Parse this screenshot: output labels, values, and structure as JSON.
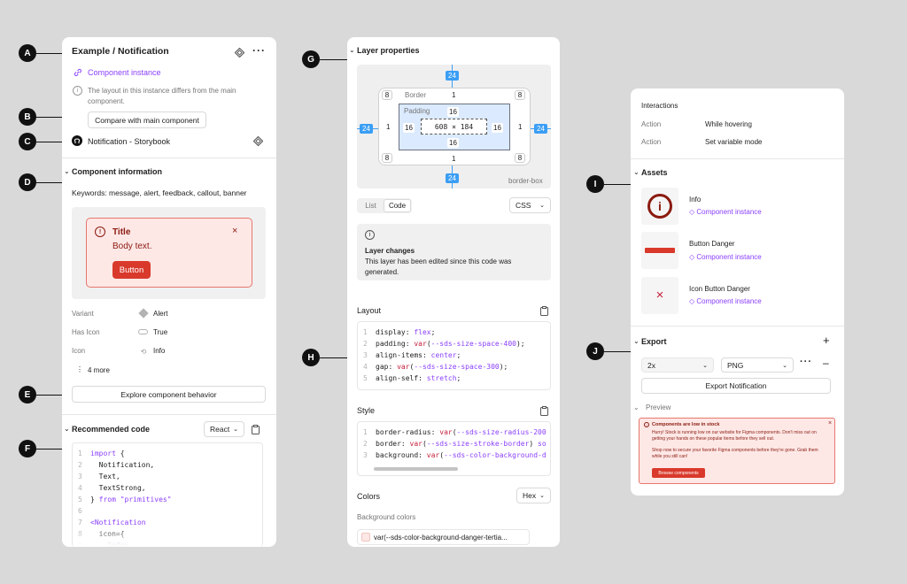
{
  "markers": [
    "A",
    "B",
    "C",
    "D",
    "E",
    "F",
    "G",
    "H",
    "I",
    "J"
  ],
  "left": {
    "title": "Example / Notification",
    "component_instance": "Component instance",
    "diff_note": "The layout in this instance differs from the main component.",
    "compare_btn": "Compare with main component",
    "storybook": "Notification - Storybook",
    "section_info": "Component information",
    "keywords": "Keywords: message, alert, feedback, callout, banner",
    "preview": {
      "title": "Title",
      "body": "Body text.",
      "button": "Button"
    },
    "props": [
      {
        "label": "Variant",
        "value": "Alert"
      },
      {
        "label": "Has Icon",
        "value": "True"
      },
      {
        "label": "Icon",
        "value": "Info"
      }
    ],
    "more": "4 more",
    "explore_btn": "Explore component behavior",
    "recommended": "Recommended code",
    "framework": "React",
    "code": [
      "1",
      "2",
      "3",
      "4",
      "5",
      "6",
      "7",
      "8"
    ]
  },
  "mid": {
    "title": "Layer properties",
    "box": {
      "outer": "24",
      "border": "Border",
      "b1": "1",
      "padding": "Padding",
      "p16": "16",
      "size": "608 × 184",
      "corner": "8",
      "border_box": "border-box"
    },
    "tabs": [
      "List",
      "Code"
    ],
    "format": "CSS",
    "changes_title": "Layer changes",
    "changes_body": "This layer has been edited since this code was generated.",
    "layout": "Layout",
    "style": "Style",
    "colors": "Colors",
    "hex": "Hex",
    "bg_colors": "Background colors",
    "bg_var": "var(--sds-color-background-danger-tertia..."
  },
  "right": {
    "interactions": "Interactions",
    "rows": [
      {
        "label": "Action",
        "value": "While hovering"
      },
      {
        "label": "Action",
        "value": "Set variable mode"
      }
    ],
    "assets": "Assets",
    "asset_items": [
      {
        "name": "Info",
        "type": "Component instance"
      },
      {
        "name": "Button Danger",
        "type": "Component instance"
      },
      {
        "name": "Icon Button Danger",
        "type": "Component instance"
      }
    ],
    "export": "Export",
    "scale": "2x",
    "fmt": "PNG",
    "export_btn": "Export Notification",
    "preview": "Preview",
    "pv_title": "Components are low in stock",
    "pv_body1": "Hurry! Stock is running low on our website for Figma components. Don't miss out on getting your hands on these popular items before they sell out.",
    "pv_body2": "Shop now to secure your favorite Figma components before they're gone. Grab them while you still can!",
    "pv_btn": "Browse components"
  },
  "colors": {
    "accent": "#8a3ffc",
    "danger": "#c41e3a",
    "danger_bg": "#fde8e6",
    "blue": "#3b9ef5"
  }
}
